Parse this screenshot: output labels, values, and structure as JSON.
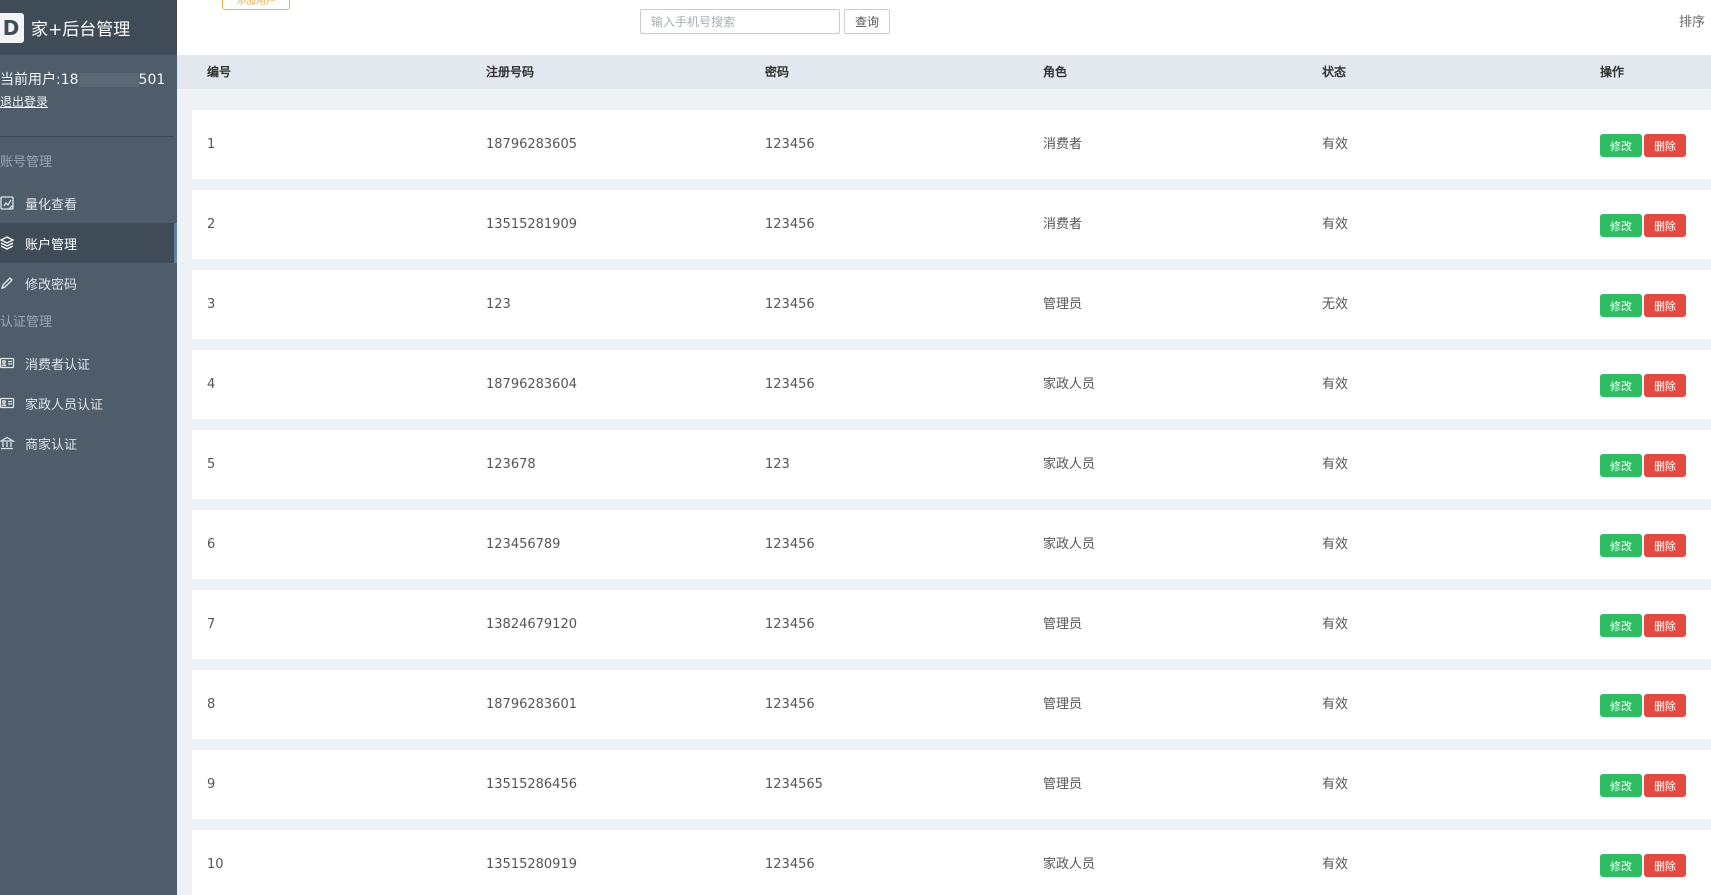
{
  "brand": {
    "logo_letter": "D",
    "title": "家+后台管理"
  },
  "user": {
    "current_label": "当前用户:18",
    "current_suffix": "501",
    "logout_label": "退出登录"
  },
  "sidebar": {
    "sections": [
      {
        "title": "账号管理",
        "items": [
          {
            "label": "量化查看",
            "icon": "report-icon",
            "active": false
          },
          {
            "label": "账户管理",
            "icon": "layers-icon",
            "active": true
          },
          {
            "label": "修改密码",
            "icon": "pencil-icon",
            "active": false
          }
        ]
      },
      {
        "title": "认证管理",
        "items": [
          {
            "label": "消费者认证",
            "icon": "id-card-icon",
            "active": false
          },
          {
            "label": "家政人员认证",
            "icon": "id-card-icon",
            "active": false
          },
          {
            "label": "商家认证",
            "icon": "bank-icon",
            "active": false
          }
        ]
      }
    ]
  },
  "toolbar": {
    "add_label": "添加用户",
    "search_placeholder": "输入手机号搜索",
    "search_button": "查询",
    "sort_label": "排序"
  },
  "table": {
    "columns": [
      "编号",
      "注册号码",
      "密码",
      "角色",
      "状态",
      "操作"
    ],
    "edit_label": "修改",
    "delete_label": "删除",
    "rows": [
      {
        "id": "1",
        "phone": "18796283605",
        "password": "123456",
        "role": "消费者",
        "status": "有效"
      },
      {
        "id": "2",
        "phone": "13515281909",
        "password": "123456",
        "role": "消费者",
        "status": "有效"
      },
      {
        "id": "3",
        "phone": "123",
        "password": "123456",
        "role": "管理员",
        "status": "无效"
      },
      {
        "id": "4",
        "phone": "18796283604",
        "password": "123456",
        "role": "家政人员",
        "status": "有效"
      },
      {
        "id": "5",
        "phone": "123678",
        "password": "123",
        "role": "家政人员",
        "status": "有效"
      },
      {
        "id": "6",
        "phone": "123456789",
        "password": "123456",
        "role": "家政人员",
        "status": "有效"
      },
      {
        "id": "7",
        "phone": "13824679120",
        "password": "123456",
        "role": "管理员",
        "status": "有效"
      },
      {
        "id": "8",
        "phone": "18796283601",
        "password": "123456",
        "role": "管理员",
        "status": "有效"
      },
      {
        "id": "9",
        "phone": "13515286456",
        "password": "1234565",
        "role": "管理员",
        "status": "有效"
      },
      {
        "id": "10",
        "phone": "13515280919",
        "password": "123456",
        "role": "家政人员",
        "status": "有效"
      }
    ]
  },
  "colors": {
    "sidebar_bg": "#4f5d6b",
    "brand_bg": "#3f4b57",
    "edit_green": "#2fbd63",
    "delete_red": "#e24a3f",
    "add_orange": "#f0ad4e"
  }
}
